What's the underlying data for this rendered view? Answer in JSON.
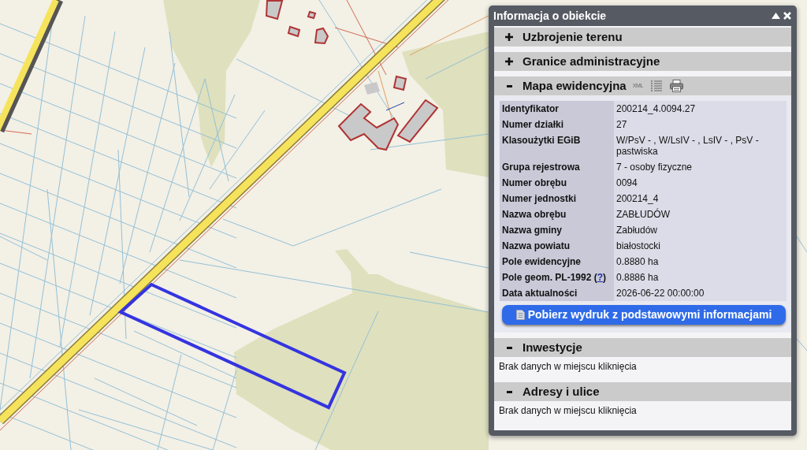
{
  "window": {
    "title": "Informacja o obiekcie"
  },
  "sections": [
    {
      "title": "Uzbrojenie terenu",
      "expanded": false
    },
    {
      "title": "Granice administracyjne",
      "expanded": false
    },
    {
      "title": "Mapa ewidencyjna",
      "expanded": true,
      "tools": [
        {
          "kind": "xml",
          "label": "XML"
        },
        {
          "kind": "list"
        },
        {
          "kind": "print"
        }
      ],
      "attributes": [
        {
          "label": "Identyfikator",
          "value": "200214_4.0094.27"
        },
        {
          "label": "Numer działki",
          "value": "27"
        },
        {
          "label": "Klasoużytki EGiB",
          "value": "W/PsV - , W/LsIV - , LsIV - , PsV - pastwiska"
        },
        {
          "label": "Grupa rejestrowa",
          "value": "7 - osoby fizyczne"
        },
        {
          "label": "Numer obrębu",
          "value": "0094"
        },
        {
          "label": "Numer jednostki",
          "value": "200214_4"
        },
        {
          "label": "Nazwa obrębu",
          "value": "ZABŁUDÓW"
        },
        {
          "label": "Nazwa gminy",
          "value": "Zabłudów"
        },
        {
          "label": "Nazwa powiatu",
          "value": "białostocki"
        },
        {
          "label": "Pole ewidencyjne",
          "value": "0.8880 ha"
        },
        {
          "label": "Pole geom. PL-1992 (",
          "link": "?",
          "label_end": ")",
          "value": "0.8886 ha"
        },
        {
          "label": "Data aktualności",
          "value": "2026-06-22 00:00:00"
        }
      ],
      "button": {
        "label": "Pobierz wydruk z podstawowymi informacjami"
      }
    },
    {
      "title": "Inwestycje",
      "expanded": true,
      "message": "Brak danych w miejscu kliknięcia"
    },
    {
      "title": "Adresy i ulice",
      "expanded": true,
      "message": "Brak danych w miejscu kliknięcia"
    }
  ]
}
